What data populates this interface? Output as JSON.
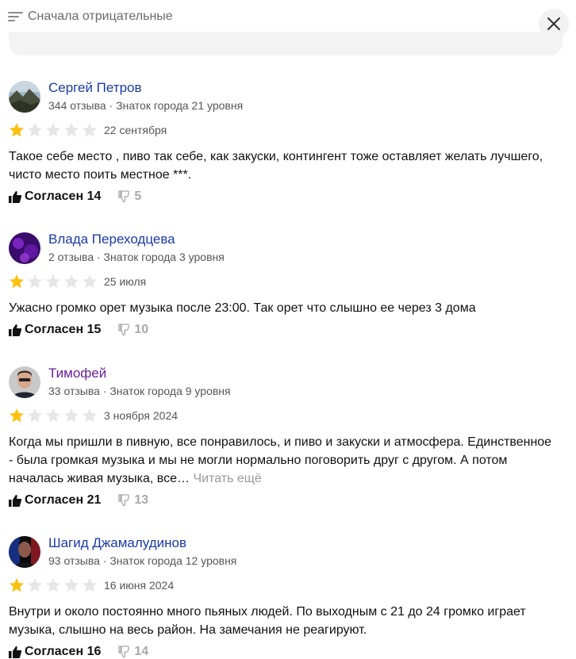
{
  "sort": {
    "label": "Сначала отрицательные",
    "icon": "sort-lines-icon"
  },
  "close": {
    "icon": "close-icon"
  },
  "colors": {
    "star_active": "#fcc111",
    "star_inactive": "#e6e6e6",
    "link": "#1a3aa8",
    "visited_link": "#6a1f9a"
  },
  "reviews": [
    {
      "author": "Сергей Петров",
      "meta": "344 отзыва · Знаток города 21 уровня",
      "rating": 1,
      "date": "22 сентября",
      "text": "Такое себе место , пиво так себе, как закуски, контингент тоже оставляет желать лучшего, чисто место поить местное ***.",
      "more": "",
      "agree": "Согласен 14",
      "disagree": "5"
    },
    {
      "author": "Влада Переходцева",
      "meta": "2 отзыва · Знаток города 3 уровня",
      "rating": 1,
      "date": "25 июля",
      "text": "Ужасно громко орет музыка после 23:00. Так орет что слышно ее через 3 дома",
      "more": "",
      "agree": "Согласен 15",
      "disagree": "10"
    },
    {
      "author": "Тимофей",
      "meta": "33 отзыва · Знаток города 9 уровня",
      "rating": 1,
      "date": "3 ноября 2024",
      "text": "Когда мы пришли в пивную, все понравилось, и пиво и закуски и атмосфера. Единственное - была громкая музыка и мы не могли нормально поговорить друг с другом. А потом началась живая музыка, все…",
      "more": "Читать ещё",
      "agree": "Согласен 21",
      "disagree": "13"
    },
    {
      "author": "Шагид Джамалудинов",
      "meta": "93 отзыва · Знаток города 12 уровня",
      "rating": 1,
      "date": "16 июня 2024",
      "text": "Внутри и около постоянно много пьяных людей. По выходным с 21 до 24 громко играет музыка, слышно на весь район. На замечания не реагируют.",
      "more": "",
      "agree": "Согласен 16",
      "disagree": "14"
    }
  ]
}
